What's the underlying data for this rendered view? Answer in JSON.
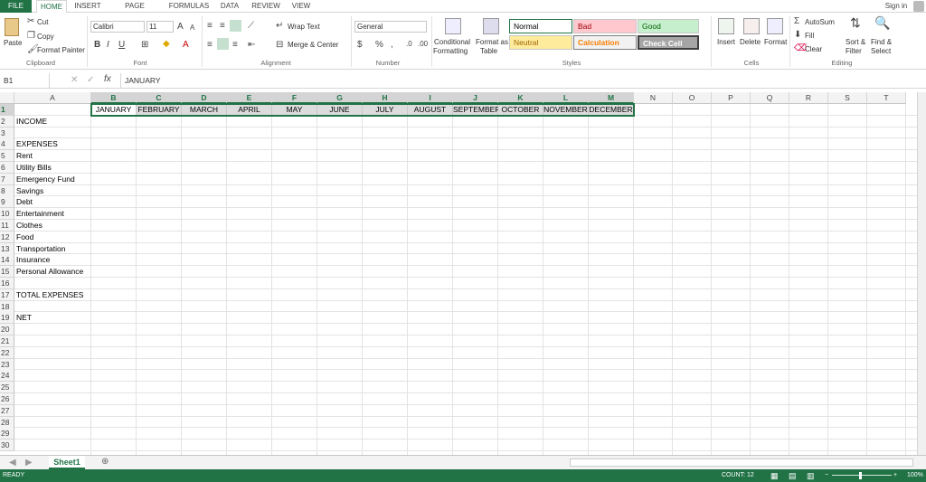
{
  "tabs": [
    "FILE",
    "HOME",
    "INSERT",
    "PAGE LAYOUT",
    "FORMULAS",
    "DATA",
    "REVIEW",
    "VIEW"
  ],
  "signin": "Sign in",
  "clipboard": {
    "paste": "Paste",
    "cut": "Cut",
    "copy": "Copy",
    "format_painter": "Format Painter",
    "label": "Clipboard"
  },
  "font": {
    "name": "Calibri",
    "size": "11",
    "label": "Font"
  },
  "alignment": {
    "wrap": "Wrap Text",
    "merge": "Merge & Center",
    "label": "Alignment"
  },
  "number": {
    "format": "General",
    "label": "Number",
    "dollar": "$",
    "percent": "%",
    "comma": ","
  },
  "styles": {
    "conditional": [
      "Conditional",
      "Formatting"
    ],
    "format_table": [
      "Format as",
      "Table"
    ],
    "normal": "Normal",
    "bad": "Bad",
    "good": "Good",
    "neutral": "Neutral",
    "calculation": "Calculation",
    "check_cell": "Check Cell",
    "label": "Styles"
  },
  "cells": {
    "insert": "Insert",
    "delete": "Delete",
    "format": "Format",
    "label": "Cells"
  },
  "editing": {
    "autosum": "AutoSum",
    "fill": "Fill",
    "clear": "Clear",
    "sort": [
      "Sort &",
      "Filter"
    ],
    "find": [
      "Find &",
      "Select"
    ],
    "label": "Editing"
  },
  "namebox": "B1",
  "formula": "JANUARY",
  "columns": [
    "A",
    "B",
    "C",
    "D",
    "E",
    "F",
    "G",
    "H",
    "I",
    "J",
    "K",
    "L",
    "M",
    "N",
    "O",
    "P",
    "Q",
    "R",
    "S",
    "T"
  ],
  "months": [
    "JANUARY",
    "FEBRUARY",
    "MARCH",
    "APRIL",
    "MAY",
    "JUNE",
    "JULY",
    "AUGUST",
    "SEPTEMBER",
    "OCTOBER",
    "NOVEMBER",
    "DECEMBER"
  ],
  "row_labels": [
    "",
    "INCOME",
    "",
    "EXPENSES",
    "Rent",
    "Utility Bills",
    "Emergency Fund",
    "Savings",
    "Debt",
    "Entertainment",
    "Clothes",
    "Food",
    "Transportation",
    "Insurance",
    "Personal Allowance",
    "",
    "TOTAL EXPENSES",
    "",
    "NET"
  ],
  "rows": [
    "1",
    "2",
    "3",
    "4",
    "5",
    "6",
    "7",
    "8",
    "9",
    "10",
    "11",
    "12",
    "13",
    "14",
    "15",
    "16",
    "17",
    "18",
    "19",
    "20",
    "21",
    "22",
    "23",
    "24",
    "25",
    "26",
    "27",
    "28",
    "29",
    "30"
  ],
  "sheet": "Sheet1",
  "status": {
    "ready": "READY",
    "count": "COUNT: 12",
    "zoom": "100%"
  },
  "accent": "#217346"
}
